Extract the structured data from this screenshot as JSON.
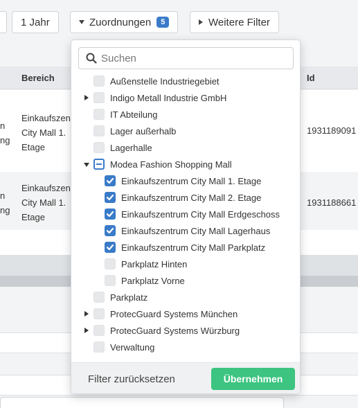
{
  "filterbar": {
    "year_label": "1 Jahr",
    "assign_label": "Zuordnungen",
    "assign_count": "5",
    "more_label": "Weitere Filter"
  },
  "table": {
    "headers": {
      "bereich": "Bereich",
      "id": "Id"
    },
    "rows": [
      {
        "left1": "n",
        "left2": "ng",
        "bereich1": "Einkaufszen",
        "bereich2": "City Mall 1.",
        "bereich3": "Etage",
        "id": "1931189091"
      },
      {
        "left1": "n",
        "left2": "ng",
        "bereich1": "Einkaufszen",
        "bereich2": "City Mall 1.",
        "bereich3": "Etage",
        "id": "1931188661"
      }
    ]
  },
  "dropdown": {
    "search_placeholder": "Suchen",
    "items": [
      {
        "label": "Außenstelle Industriegebiet",
        "level": 0,
        "state": "unchecked",
        "caret": "none"
      },
      {
        "label": "Indigo Metall Industrie GmbH",
        "level": 0,
        "state": "unchecked",
        "caret": "right"
      },
      {
        "label": "IT Abteilung",
        "level": 0,
        "state": "unchecked",
        "caret": "none"
      },
      {
        "label": "Lager außerhalb",
        "level": 0,
        "state": "unchecked",
        "caret": "none"
      },
      {
        "label": "Lagerhalle",
        "level": 0,
        "state": "unchecked",
        "caret": "none"
      },
      {
        "label": "Modea Fashion Shopping Mall",
        "level": 0,
        "state": "partial",
        "caret": "down"
      },
      {
        "label": "Einkaufszentrum City Mall 1. Etage",
        "level": 1,
        "state": "checked",
        "caret": "none"
      },
      {
        "label": "Einkaufszentrum City Mall 2. Etage",
        "level": 1,
        "state": "checked",
        "caret": "none"
      },
      {
        "label": "Einkaufszentrum City Mall Erdgeschoss",
        "level": 1,
        "state": "checked",
        "caret": "none"
      },
      {
        "label": "Einkaufszentrum City Mall Lagerhaus",
        "level": 1,
        "state": "checked",
        "caret": "none"
      },
      {
        "label": "Einkaufszentrum City Mall Parkplatz",
        "level": 1,
        "state": "checked",
        "caret": "none"
      },
      {
        "label": "Parkplatz Hinten",
        "level": 1,
        "state": "unchecked",
        "caret": "none"
      },
      {
        "label": "Parkplatz Vorne",
        "level": 1,
        "state": "unchecked",
        "caret": "none"
      },
      {
        "label": "Parkplatz",
        "level": 0,
        "state": "unchecked",
        "caret": "none"
      },
      {
        "label": "ProtecGuard Systems München",
        "level": 0,
        "state": "unchecked",
        "caret": "right"
      },
      {
        "label": "ProtecGuard Systems Würzburg",
        "level": 0,
        "state": "unchecked",
        "caret": "right"
      },
      {
        "label": "Verwaltung",
        "level": 0,
        "state": "unchecked",
        "caret": "none"
      }
    ],
    "reset_label": "Filter zurücksetzen",
    "apply_label": "Übernehmen"
  },
  "colors": {
    "accent": "#3a7bc8",
    "apply": "#3cc480"
  },
  "icons": {
    "search": "search-icon",
    "check": "checkmark-icon"
  }
}
